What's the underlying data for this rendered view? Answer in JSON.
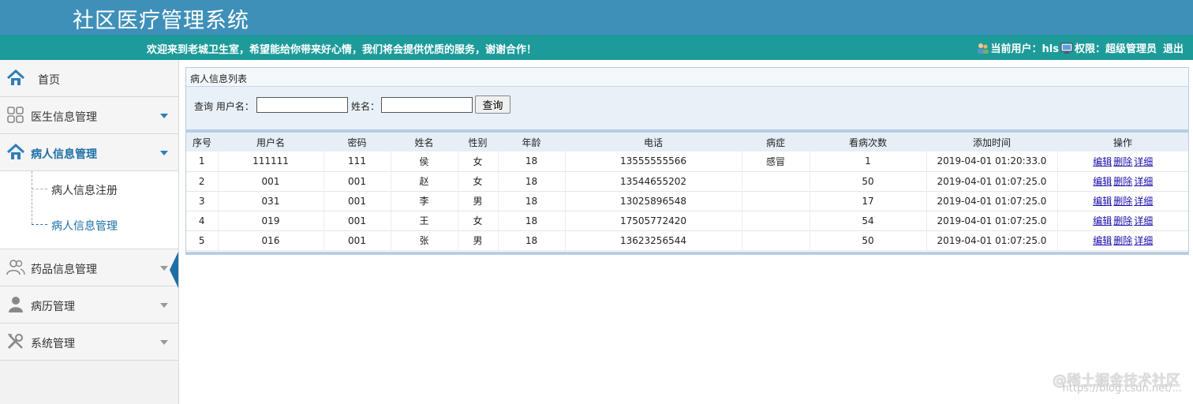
{
  "header": {
    "title": "社区医疗管理系统"
  },
  "topbar": {
    "welcome": "欢迎来到老城卫生室，希望能给你带来好心情，我们将会提供优质的服务，谢谢合作！",
    "current_user_label": "当前用户：hls",
    "permission_label": "权限：超级管理员",
    "logout": "退出"
  },
  "sidebar": {
    "items": [
      {
        "label": "首页",
        "icon": "home-icon"
      },
      {
        "label": "医生信息管理",
        "icon": "grid-icon"
      },
      {
        "label": "病人信息管理",
        "icon": "home-icon"
      },
      {
        "label": "药品信息管理",
        "icon": "users-icon"
      },
      {
        "label": "病历管理",
        "icon": "user-icon"
      },
      {
        "label": "系统管理",
        "icon": "tools-icon"
      }
    ],
    "sub_items": [
      {
        "label": "病人信息注册"
      },
      {
        "label": "病人信息管理"
      }
    ]
  },
  "panel": {
    "title": "病人信息列表",
    "search": {
      "query_label": "查询 用户名：",
      "name_label": "姓名：",
      "username_value": "",
      "name_value": "",
      "button": "查询"
    },
    "columns": [
      "序号",
      "用户名",
      "密码",
      "姓名",
      "性别",
      "年龄",
      "电话",
      "病症",
      "看病次数",
      "添加时间",
      "操作"
    ],
    "rows": [
      [
        "1",
        "111111",
        "111",
        "侯",
        "女",
        "18",
        "13555555566",
        "感冒",
        "1",
        "2019-04-01 01:20:33.0"
      ],
      [
        "2",
        "001",
        "001",
        "赵",
        "女",
        "18",
        "13544655202",
        "",
        "50",
        "2019-04-01 01:07:25.0"
      ],
      [
        "3",
        "031",
        "001",
        "李",
        "男",
        "18",
        "13025896548",
        "",
        "17",
        "2019-04-01 01:07:25.0"
      ],
      [
        "4",
        "019",
        "001",
        "王",
        "女",
        "18",
        "17505772420",
        "",
        "54",
        "2019-04-01 01:07:25.0"
      ],
      [
        "5",
        "016",
        "001",
        "张",
        "男",
        "18",
        "13623256544",
        "",
        "50",
        "2019-04-01 01:07:25.0"
      ]
    ],
    "actions": [
      "编辑",
      "删除",
      "详细"
    ]
  },
  "watermark": {
    "text": "@稀土掘金技术社区",
    "url": "https://blog.csdn.net/..."
  },
  "colors": {
    "header": "#3f90b9",
    "topbar": "#1d9a9a",
    "accent": "#1d6fa5",
    "link": "#1a0dab"
  }
}
